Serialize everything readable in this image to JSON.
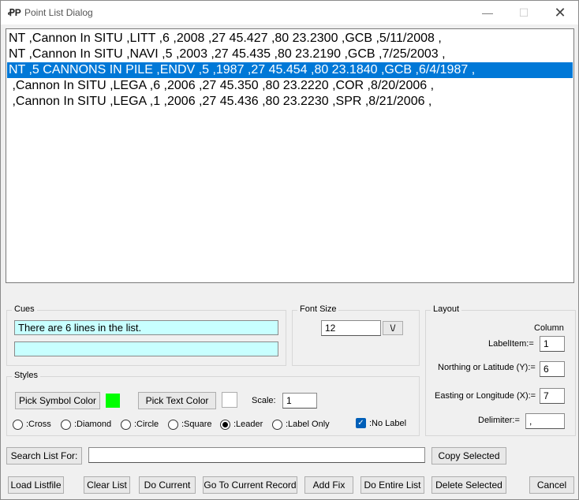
{
  "window": {
    "title": "Point List Dialog",
    "app_icon": "ꝒP",
    "minimize_icon": "—",
    "maximize_icon": "☐",
    "close_icon": "✕"
  },
  "list": {
    "rows": [
      {
        "text": "NT ,Cannon In SITU ,LITT ,6 ,2008 ,27 45.427 ,80 23.2300 ,GCB ,5/11/2008 ,",
        "selected": false
      },
      {
        "text": "NT ,Cannon In SITU ,NAVI ,5 ,2003 ,27 45.435 ,80 23.2190 ,GCB ,7/25/2003 ,",
        "selected": false
      },
      {
        "text": "NT ,5 CANNONS IN PILE ,ENDV ,5 ,1987 ,27 45.454 ,80 23.1840 ,GCB ,6/4/1987 ,",
        "selected": true
      },
      {
        "text": " ,Cannon In SITU ,LEGA ,6 ,2006 ,27 45.350 ,80 23.2220 ,COR ,8/20/2006 ,",
        "selected": false
      },
      {
        "text": " ,Cannon In SITU ,LEGA ,1 ,2006 ,27 45.436 ,80 23.2230 ,SPR ,8/21/2006 ,",
        "selected": false
      }
    ]
  },
  "cues": {
    "label": "Cues",
    "line1": "There are 6 lines in the list.",
    "line2": ""
  },
  "font_size": {
    "label": "Font Size",
    "value": "12",
    "dropdown_icon": "\\/"
  },
  "layout": {
    "label": "Layout",
    "column_header": "Column",
    "label_item": {
      "label": "LabelItem:=",
      "value": "1"
    },
    "northing": {
      "label": "Northing or Latitude (Y):=",
      "value": "6"
    },
    "easting": {
      "label": "Easting or Longitude (X):=",
      "value": "7"
    },
    "delimiter": {
      "label": "Delimiter:=",
      "value": ","
    }
  },
  "styles": {
    "label": "Styles",
    "pick_symbol_color": "Pick Symbol Color",
    "symbol_color": "#00ff00",
    "pick_text_color": "Pick Text Color",
    "text_color": "#ffffff",
    "scale_label": "Scale:",
    "scale_value": "1",
    "radios": [
      {
        "label": ":Cross",
        "checked": false
      },
      {
        "label": ":Diamond",
        "checked": false
      },
      {
        "label": ":Circle",
        "checked": false
      },
      {
        "label": ":Square",
        "checked": false
      },
      {
        "label": ":Leader",
        "checked": true
      },
      {
        "label": ":Label Only",
        "checked": false
      }
    ],
    "no_label": {
      "label": ":No Label",
      "checked": true
    }
  },
  "search": {
    "button": "Search List For:",
    "value": "",
    "copy_selected": "Copy Selected"
  },
  "bottom_buttons": {
    "load_listfile": "Load Listfile",
    "clear_list": "Clear List",
    "do_current": "Do Current",
    "go_to_current": "Go To Current Record",
    "add_fix": "Add Fix",
    "do_entire_list": "Do Entire List",
    "delete_selected": "Delete Selected",
    "cancel": "Cancel"
  }
}
